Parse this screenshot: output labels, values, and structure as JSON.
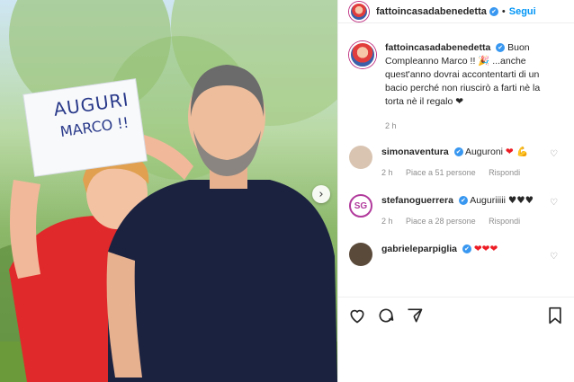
{
  "post": {
    "username": "fattoincasadabenedetta",
    "verified_mark": "✔",
    "dot": "•",
    "follow_label": "Segui",
    "sign_line1": "AUGURI",
    "sign_line2": "MARCO !!",
    "next_arrow": "›"
  },
  "caption": {
    "username": "fattoincasadabenedetta",
    "text": "Buon Compleanno Marco !! 🎉 ...anche quest'anno dovrai accontentarti di un bacio perché non riuscirò a farti nè la torta nè il regalo ❤",
    "time": "2 h"
  },
  "comments": [
    {
      "username": "simonaventura",
      "text": "Auguroni",
      "emoji": "❤ 💪",
      "time": "2 h",
      "likes": "Piace a 51 persone",
      "reply": "Rispondi",
      "avatar_color": "#d9c4b2"
    },
    {
      "username": "stefanoguerrera",
      "text": "Auguriiiii",
      "emoji": "♥♥♥",
      "time": "2 h",
      "likes": "Piace a 28 persone",
      "reply": "Rispondi",
      "avatar_initials": "SG",
      "avatar_color": "#b13a9c"
    },
    {
      "username": "gabrieleparpiglia",
      "text": "",
      "emoji": "❤❤❤",
      "avatar_color": "#5a4a3a"
    }
  ],
  "icons": [
    "heart-icon",
    "comment-icon",
    "share-icon",
    "bookmark-icon"
  ]
}
